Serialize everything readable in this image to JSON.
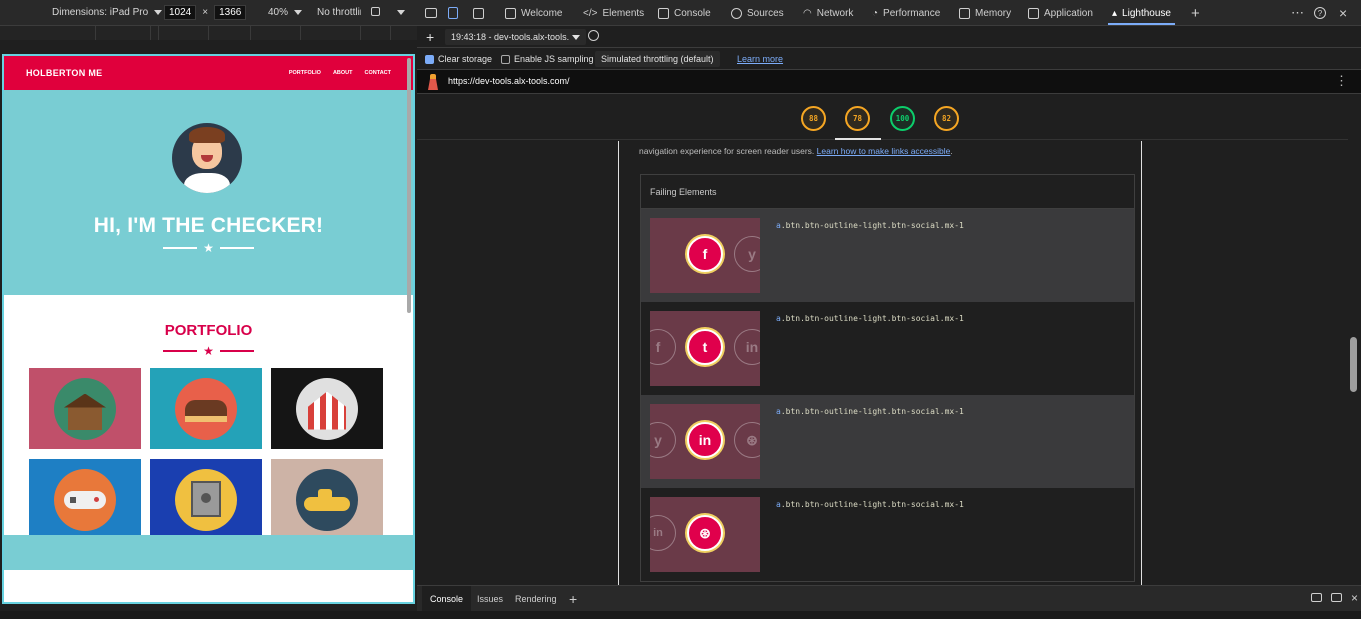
{
  "device_toolbar": {
    "dimensions_label": "Dimensions: iPad Pro",
    "width": "1024",
    "times": "×",
    "height": "1366",
    "zoom": "40%",
    "throttling": "No throttlin"
  },
  "emulated_site": {
    "brand": "HOLBERTON ME",
    "nav_links": [
      "PORTFOLIO",
      "ABOUT",
      "CONTACT"
    ],
    "hero_title": "HI, I'M THE CHECKER!",
    "portfolio_title": "PORTFOLIO",
    "tiles": [
      {
        "name": "cabin",
        "bg": "#c0506a",
        "circle": "#3a8a6a"
      },
      {
        "name": "cake",
        "bg": "#24a2b8",
        "circle": "#e8604a"
      },
      {
        "name": "circus",
        "bg": "#151515",
        "circle": "#e0e0e0"
      },
      {
        "name": "gamepad",
        "bg": "#1e7fc4",
        "circle": "#e8783a"
      },
      {
        "name": "safe",
        "bg": "#1a3fb0",
        "circle": "#f0c040"
      },
      {
        "name": "submarine",
        "bg": "#cdb3a6",
        "circle": "#2e4a5e"
      }
    ],
    "colors": {
      "brand_red": "#e0003c",
      "teal": "#79cdd3"
    }
  },
  "devtools": {
    "tabs": [
      {
        "label": "Welcome",
        "icon": "home-icon"
      },
      {
        "label": "Elements",
        "icon": "code-icon"
      },
      {
        "label": "Console",
        "icon": "console-icon"
      },
      {
        "label": "Sources",
        "icon": "gear-icon"
      },
      {
        "label": "Network",
        "icon": "wifi-icon"
      },
      {
        "label": "Performance",
        "icon": "speedometer-icon"
      },
      {
        "label": "Memory",
        "icon": "chip-icon"
      },
      {
        "label": "Application",
        "icon": "window-icon"
      },
      {
        "label": "Lighthouse",
        "icon": "lighthouse-icon",
        "active": true
      }
    ],
    "help": "?",
    "close": "×"
  },
  "lighthouse": {
    "report_select": "19:43:18 - dev-tools.alx-tools.",
    "clear_storage": "Clear storage",
    "enable_js_sampling": "Enable JS sampling",
    "throttling": "Simulated throttling (default)",
    "learn_more": "Learn more",
    "url": "https://dev-tools.alx-tools.com/",
    "scores": [
      "88",
      "78",
      "100",
      "82"
    ],
    "description": "navigation experience for screen reader users.",
    "description_link": "Learn how to make links accessible",
    "description_end": ".",
    "failing_header": "Failing Elements",
    "selector_tag": "a",
    "rows": [
      {
        "selector": ".btn.btn-outline-light.btn-social.mx-1",
        "main": "f",
        "left": "",
        "right": "y"
      },
      {
        "selector": ".btn.btn-outline-light.btn-social.mx-1",
        "main": "t",
        "left": "f",
        "right": "in"
      },
      {
        "selector": ".btn.btn-outline-light.btn-social.mx-1",
        "main": "in",
        "left": "y",
        "right": "⊛"
      },
      {
        "selector": ".btn.btn-outline-light.btn-social.mx-1",
        "main": "⊛",
        "left": "in",
        "right": ""
      }
    ]
  },
  "drawer": {
    "tabs": [
      "Console",
      "Issues",
      "Rendering"
    ],
    "add": "+"
  }
}
